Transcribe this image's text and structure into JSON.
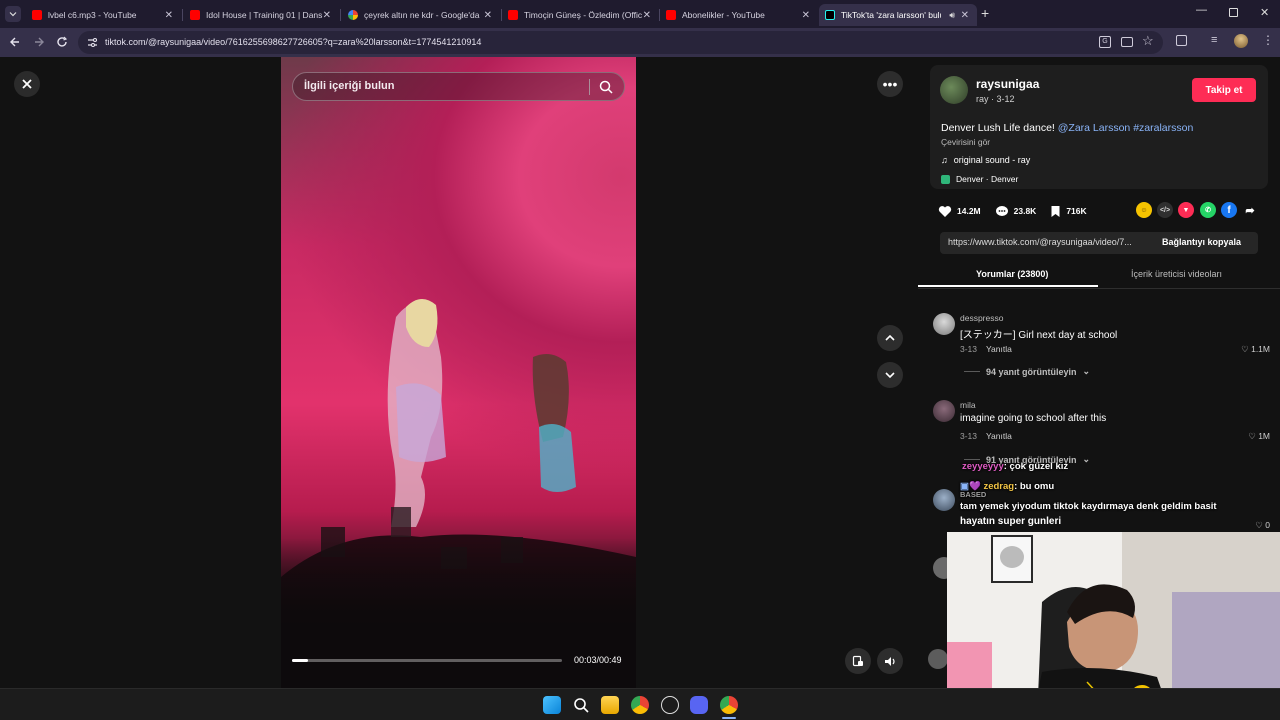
{
  "tabs": [
    {
      "title": "lvbel c6.mp3 - YouTube",
      "icon": "youtube-icon"
    },
    {
      "title": "Idol House | Training 01 | Dans",
      "icon": "youtube-icon"
    },
    {
      "title": "çeyrek altın ne kdr - Google'da",
      "icon": "google-icon"
    },
    {
      "title": "Timoçin Güneş - Özledim (Offic",
      "icon": "youtube-icon"
    },
    {
      "title": "Abonelikler - YouTube",
      "icon": "youtube-icon"
    },
    {
      "title": "TikTok'ta 'zara larsson' bulu",
      "icon": "tiktok-icon",
      "active": true
    }
  ],
  "address": {
    "url": "tiktok.com/@raysunigaa/video/7616255698627726605?q=zara%20larsson&t=1774541210914"
  },
  "video": {
    "search_placeholder": "İlgili içeriği bulun",
    "time": "00:03/00:49",
    "progress": 0.06
  },
  "author": {
    "username": "raysunigaa",
    "subline": "ray · 3-12",
    "follow_label": "Takip et"
  },
  "post": {
    "description": "Denver Lush Life dance!",
    "mention": "@Zara Larsson",
    "hashtag": "#zaralarsson",
    "translate": "Çevirisini gör",
    "sound": "original sound - ray",
    "location": "Denver · Denver"
  },
  "stats": {
    "likes": "14.2M",
    "comments": "23.8K",
    "saves": "716K"
  },
  "link": {
    "url": "https://www.tiktok.com/@raysunigaa/video/7...",
    "copy_label": "Bağlantıyı kopyala"
  },
  "panel_tabs": {
    "comments": "Yorumlar (23800)",
    "creator_videos": "İçerik üreticisi videoları"
  },
  "comments": [
    {
      "name": "desspresso",
      "text": "[ステッカー] Girl next day at school",
      "date": "3-13",
      "reply": "Yanıtla",
      "likes": "1.1M",
      "view_replies": "94 yanıt görüntüleyin"
    },
    {
      "name": "mila",
      "text": "imagine going to school after this",
      "date": "3-13",
      "reply": "Yanıtla",
      "likes": "1M",
      "view_replies": "91 yanıt görüntüleyin"
    }
  ],
  "third_comment": {
    "text": "hayatın super gunleri",
    "likes": "0"
  },
  "chat": [
    {
      "user": "zeyyeyyy",
      "message": ": çok güzel kız",
      "color": "#e05cc4"
    },
    {
      "user": "zedrag",
      "message": ": bu omu",
      "color": "#f3c646"
    },
    {
      "user": "BASED",
      "message": "",
      "color": "#9e9e9e"
    },
    {
      "user": "",
      "message": "tam yemek yiyodum tiktok kaydırmaya denk geldim basit",
      "color": "#c86bd6"
    }
  ]
}
